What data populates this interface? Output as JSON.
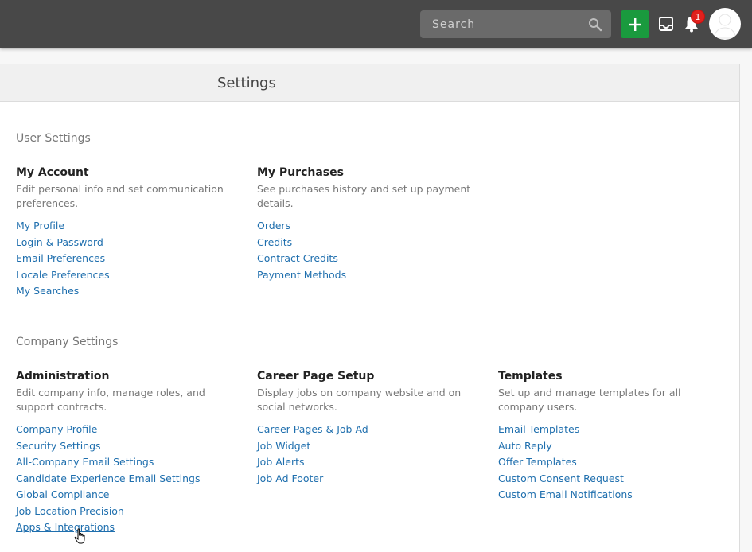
{
  "topbar": {
    "search": {
      "placeholder": "Search",
      "value": ""
    },
    "notification_count": "1",
    "icons": [
      "search-icon",
      "plus-icon",
      "inbox-icon",
      "bell-icon",
      "avatar"
    ],
    "accent_color": "#1a9a3e"
  },
  "header": {
    "title": "Settings"
  },
  "user_settings": {
    "title": "User Settings",
    "my_account": {
      "title": "My Account",
      "desc": "Edit personal info and set communication preferences.",
      "links": [
        "My Profile",
        "Login & Password",
        "Email Preferences",
        "Locale Preferences",
        "My Searches"
      ]
    },
    "my_purchases": {
      "title": "My Purchases",
      "desc": "See purchases history and set up payment details.",
      "links": [
        "Orders",
        "Credits",
        "Contract Credits",
        "Payment Methods"
      ]
    }
  },
  "company_settings": {
    "title": "Company Settings",
    "administration": {
      "title": "Administration",
      "desc": "Edit company info, manage roles, and support contracts.",
      "links": [
        "Company Profile",
        "Security Settings",
        "All-Company Email Settings",
        "Candidate Experience Email Settings",
        "Global Compliance",
        "Job Location Precision",
        "Apps & Integrations"
      ]
    },
    "career_page": {
      "title": "Career Page Setup",
      "desc": "Display jobs on company website and on social networks.",
      "links": [
        "Career Pages & Job Ad",
        "Job Widget",
        "Job Alerts",
        "Job Ad Footer"
      ]
    },
    "templates": {
      "title": "Templates",
      "desc": "Set up and manage templates for all company users.",
      "links": [
        "Email Templates",
        "Auto Reply",
        "Offer Templates",
        "Custom Consent Request",
        "Custom Email Notifications"
      ]
    }
  }
}
